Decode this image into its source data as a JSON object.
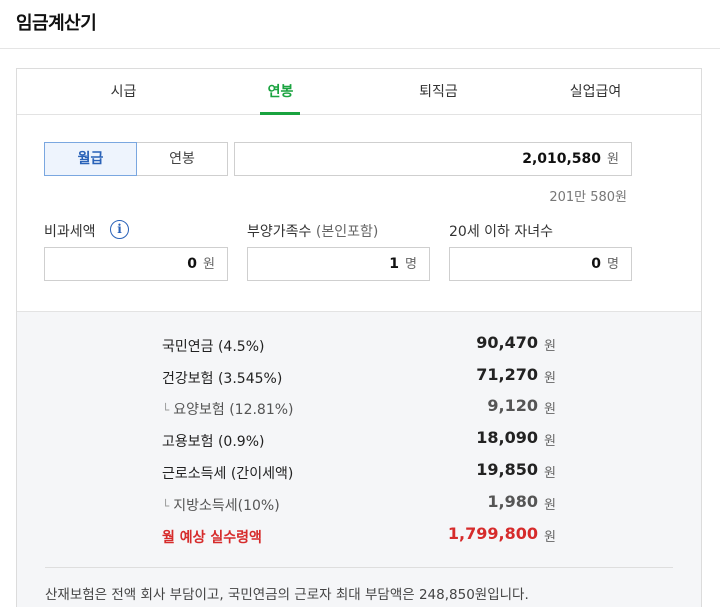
{
  "page": {
    "title": "임금계산기"
  },
  "tabs": [
    {
      "label": "시급"
    },
    {
      "label": "연봉"
    },
    {
      "label": "퇴직금"
    },
    {
      "label": "실업급여"
    }
  ],
  "active_tab": "연봉",
  "pay_type": {
    "options": [
      "월급",
      "연봉"
    ],
    "selected": "월급"
  },
  "salary": {
    "value": "2,010,580",
    "unit": "원",
    "hint": "201만 580원"
  },
  "nontaxable": {
    "label": "비과세액",
    "value": "0",
    "unit": "원"
  },
  "dependents": {
    "label": "부양가족수",
    "label_sub": "(본인포함)",
    "value": "1",
    "unit": "명"
  },
  "children": {
    "label": "20세 이하 자녀수",
    "value": "0",
    "unit": "명"
  },
  "deductions": [
    {
      "name": "국민연금 (4.5%)",
      "amount": "90,470",
      "unit": "원",
      "sub": false
    },
    {
      "name": "건강보험 (3.545%)",
      "amount": "71,270",
      "unit": "원",
      "sub": false
    },
    {
      "name": "요양보험 (12.81%)",
      "amount": "9,120",
      "unit": "원",
      "sub": true
    },
    {
      "name": "고용보험 (0.9%)",
      "amount": "18,090",
      "unit": "원",
      "sub": false
    },
    {
      "name": "근로소득세 (간이세액)",
      "amount": "19,850",
      "unit": "원",
      "sub": false
    },
    {
      "name": "지방소득세(10%)",
      "amount": "1,980",
      "unit": "원",
      "sub": true
    }
  ],
  "total": {
    "name": "월 예상 실수령액",
    "amount": "1,799,800",
    "unit": "원"
  },
  "note": "산재보험은 전액 회사 부담이고, 국민연금의 근로자 최대 부담액은 248,850원입니다.",
  "colors": {
    "accent_green": "#19a33f",
    "accent_blue": "#2a62b8",
    "total_red": "#d62b2b"
  },
  "icons": {
    "info": "info-icon"
  }
}
